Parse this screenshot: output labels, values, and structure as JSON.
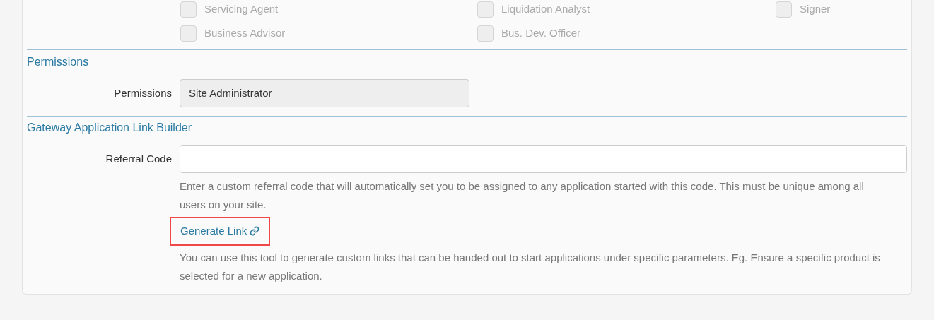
{
  "roles": [
    {
      "label": "Servicing Agent",
      "checked": false
    },
    {
      "label": "Liquidation Analyst",
      "checked": false
    },
    {
      "label": "Signer",
      "checked": false
    },
    {
      "label": "Business Advisor",
      "checked": false
    },
    {
      "label": "Bus. Dev. Officer",
      "checked": false
    }
  ],
  "permissions": {
    "heading": "Permissions",
    "label": "Permissions",
    "value": "Site Administrator"
  },
  "link_builder": {
    "heading": "Gateway Application Link Builder",
    "label": "Referral Code",
    "help": "Enter a custom referral code that will automatically set you to be assigned to any application started with this code. This must be unique among all users on your site.",
    "link": "Generate Link",
    "highlighted": true,
    "link_help": "You can use this tool to generate custom links that can be handed out to start applications under specific parameters. Eg. Ensure a specific product is selected for a new application."
  }
}
